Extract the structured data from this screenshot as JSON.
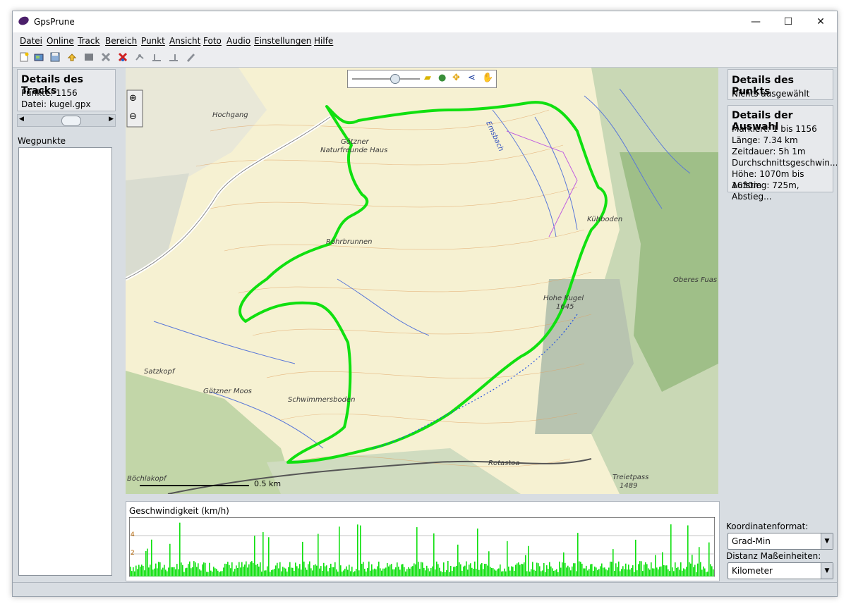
{
  "window": {
    "title": "GpsPrune",
    "minimize": "—",
    "maximize": "☐",
    "close": "✕"
  },
  "menu": [
    "Datei",
    "Online",
    "Track",
    "Bereich",
    "Punkt",
    "Ansicht",
    "Foto",
    "Audio",
    "Einstellungen",
    "Hilfe"
  ],
  "toolbar": {
    "icons": [
      "open-file-icon",
      "add-photo-icon",
      "save-icon",
      "undo-icon",
      "stop-icon",
      "delete-point-icon",
      "delete-range-icon",
      "connect-icon",
      "add-point-icon",
      "add-point-after-icon",
      "edit-icon"
    ]
  },
  "track_details": {
    "title": "Details des Tracks",
    "points": "Punkte: 1156",
    "file": "Datei: kugel.gpx"
  },
  "waypoints": {
    "label": "Wegpunkte"
  },
  "point_details": {
    "title": "Details des Punkts",
    "selection": "Nichts ausgewählt"
  },
  "range_details": {
    "title": "Details der Auswahl",
    "lines": [
      "Markiert: 1 bis 1156",
      "Länge: 7.34 km",
      "Zeitdauer: 5h 1m",
      "Durchschnittsgeschwin...",
      "Höhe: 1070m bis 1630m",
      "Aufstieg: 725m, Abstieg..."
    ]
  },
  "settings": {
    "coord_label": "Koordinatenformat:",
    "coord_value": "Grad-Min",
    "dist_label": "Distanz Maßeinheiten:",
    "dist_value": "Kilometer"
  },
  "map": {
    "labels": [
      {
        "text": "Hochgang"
      },
      {
        "text": "Götzner"
      },
      {
        "text": "Naturfreunde Haus"
      },
      {
        "text": "Rohrbrunnen"
      },
      {
        "text": "Kühboden"
      },
      {
        "text": "Oberes Fuas"
      },
      {
        "text": "Hohe Kugel"
      },
      {
        "text": "1645"
      },
      {
        "text": "Satzkopf"
      },
      {
        "text": "Götzner Moos"
      },
      {
        "text": "Schwimmersboden"
      },
      {
        "text": "Rotastoa"
      },
      {
        "text": "Treietpass"
      },
      {
        "text": "1489"
      },
      {
        "text": "Böchlakopf"
      },
      {
        "text": "Emsbach"
      }
    ],
    "scale_label": "0.5 km"
  },
  "profile": {
    "title": "Geschwindigkeit (km/h)",
    "y_ticks": [
      "4",
      "2"
    ]
  },
  "colors": {
    "track": "#10e010",
    "window_bg": "#d8dde2",
    "map_bg": "#f5f1d5"
  }
}
